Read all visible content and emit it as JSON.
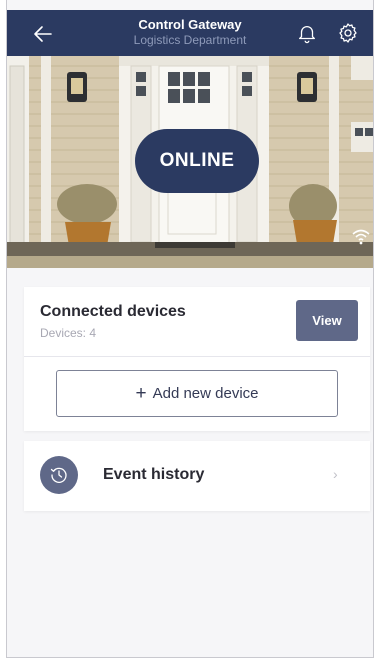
{
  "header": {
    "title": "Control Gateway",
    "subtitle": "Logistics Department",
    "back_icon": "arrow-left-icon",
    "bell_icon": "bell-icon",
    "settings_icon": "gear-icon",
    "background_color": "#2b3a61"
  },
  "hero": {
    "status_label": "ONLINE",
    "status_badge_color": "#2b3a61",
    "wifi_icon": "wifi-icon"
  },
  "devices": {
    "title": "Connected devices",
    "count_label": "Devices: 4",
    "view_label": "View",
    "add_plus": "+",
    "add_label": "Add new device"
  },
  "events": {
    "label": "Event history",
    "icon": "history-clock-icon",
    "chevron": "›"
  },
  "colors": {
    "accent": "#5f6888",
    "background": "#f6f6f8"
  }
}
